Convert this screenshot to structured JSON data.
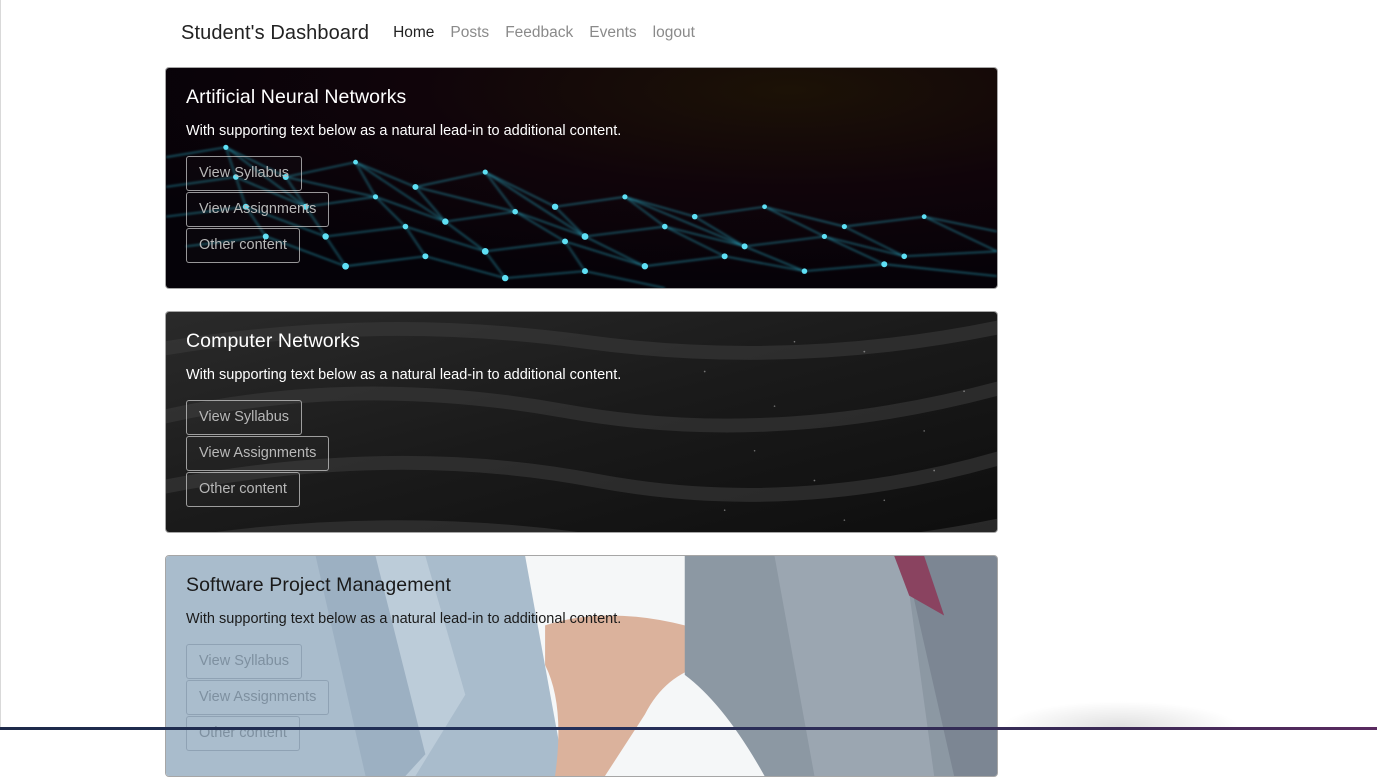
{
  "navbar": {
    "brand": "Student's Dashboard",
    "links": [
      {
        "label": "Home",
        "active": true
      },
      {
        "label": "Posts",
        "active": false
      },
      {
        "label": "Feedback",
        "active": false
      },
      {
        "label": "Events",
        "active": false
      },
      {
        "label": "logout",
        "active": false
      }
    ]
  },
  "cards": [
    {
      "title": "Artificial Neural Networks",
      "text": "With supporting text below as a natural lead-in to additional content.",
      "buttons": [
        "View Syllabus",
        "View Assignments",
        "Other content"
      ],
      "background": "neural-network-image"
    },
    {
      "title": "Computer Networks",
      "text": "With supporting text below as a natural lead-in to additional content.",
      "buttons": [
        "View Syllabus",
        "View Assignments",
        "Other content"
      ],
      "background": "dark-sand-image"
    },
    {
      "title": "Software Project Management",
      "text": "With supporting text below as a natural lead-in to additional content.",
      "buttons": [
        "View Syllabus",
        "View Assignments",
        "Other content"
      ],
      "background": "handshake-image"
    }
  ],
  "colors": {
    "brand_text": "#222222",
    "nav_inactive": "#8a8a8a",
    "network_glow": "#2ec8e6"
  }
}
